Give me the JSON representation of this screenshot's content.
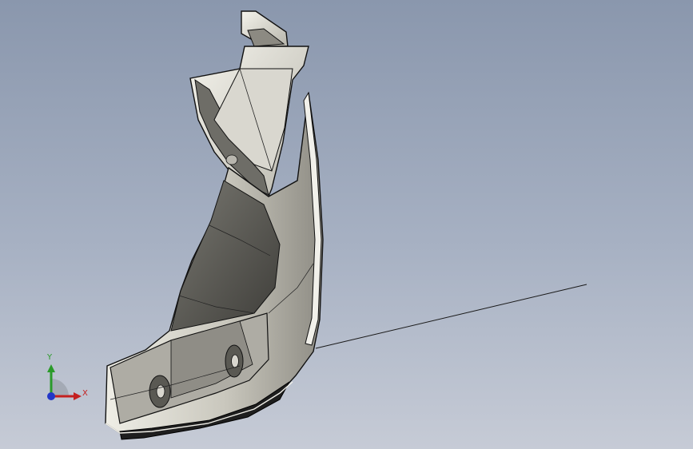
{
  "viewport": {
    "background_top": "#8a97ad",
    "background_bottom": "#c6cbd6"
  },
  "model": {
    "shell_color": "#c9c7bd",
    "edge_color": "#111111",
    "shadow_color": "#2a2a2a"
  },
  "triad": {
    "y_label": "Y",
    "x_label": "X",
    "y_color": "#2a9a2a",
    "x_color": "#c42020",
    "z_color": "#2236c8"
  }
}
